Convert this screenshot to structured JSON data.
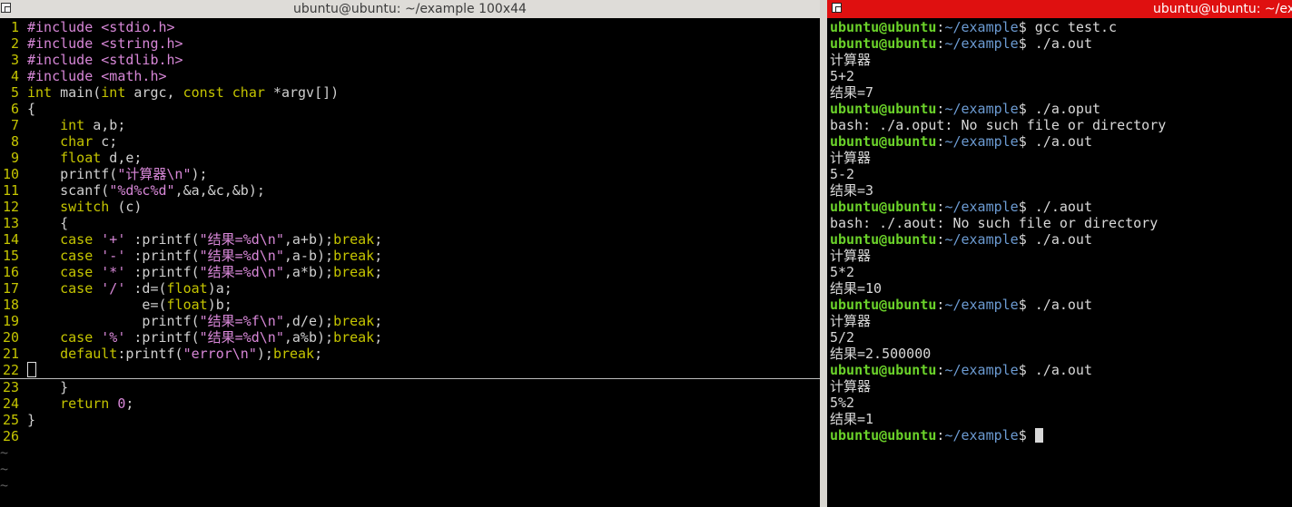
{
  "left_window": {
    "title": "ubuntu@ubuntu: ~/example 100x44",
    "icon": "terminal-window-icon"
  },
  "right_window": {
    "title": "ubuntu@ubuntu: ~/exa",
    "icon": "terminal-window-icon"
  },
  "vim": {
    "lines": [
      {
        "n": "1",
        "t": [
          [
            "pp",
            "#include "
          ],
          [
            "inc",
            "<stdio.h>"
          ]
        ]
      },
      {
        "n": "2",
        "t": [
          [
            "pp",
            "#include "
          ],
          [
            "inc",
            "<string.h>"
          ]
        ]
      },
      {
        "n": "3",
        "t": [
          [
            "pp",
            "#include "
          ],
          [
            "inc",
            "<stdlib.h>"
          ]
        ]
      },
      {
        "n": "4",
        "t": [
          [
            "pp",
            "#include "
          ],
          [
            "inc",
            "<math.h>"
          ]
        ]
      },
      {
        "n": "5",
        "t": [
          [
            "ty",
            "int"
          ],
          [
            "pl",
            " main("
          ],
          [
            "ty",
            "int"
          ],
          [
            "pl",
            " argc, "
          ],
          [
            "ty",
            "const"
          ],
          [
            "pl",
            " "
          ],
          [
            "ty",
            "char"
          ],
          [
            "pl",
            " *argv[])"
          ]
        ]
      },
      {
        "n": "6",
        "t": [
          [
            "pl",
            "{"
          ]
        ]
      },
      {
        "n": "7",
        "t": [
          [
            "pl",
            "    "
          ],
          [
            "ty",
            "int"
          ],
          [
            "pl",
            " a,b;"
          ]
        ]
      },
      {
        "n": "8",
        "t": [
          [
            "pl",
            "    "
          ],
          [
            "ty",
            "char"
          ],
          [
            "pl",
            " c;"
          ]
        ]
      },
      {
        "n": "9",
        "t": [
          [
            "pl",
            "    "
          ],
          [
            "ty",
            "float"
          ],
          [
            "pl",
            " d,e;"
          ]
        ]
      },
      {
        "n": "10",
        "t": [
          [
            "pl",
            "    printf("
          ],
          [
            "st",
            "\"计算器"
          ],
          [
            "nm",
            "\\n"
          ],
          [
            "st",
            "\""
          ],
          [
            "pl",
            ");"
          ]
        ]
      },
      {
        "n": "11",
        "t": [
          [
            "pl",
            "    scanf("
          ],
          [
            "st",
            "\""
          ],
          [
            "nm",
            "%d%c%d"
          ],
          [
            "st",
            "\""
          ],
          [
            "pl",
            ",&a,&c,&b);"
          ]
        ]
      },
      {
        "n": "12",
        "t": [
          [
            "pl",
            "    "
          ],
          [
            "kw",
            "switch"
          ],
          [
            "pl",
            " (c)"
          ]
        ]
      },
      {
        "n": "13",
        "t": [
          [
            "pl",
            "    {"
          ]
        ]
      },
      {
        "n": "14",
        "t": [
          [
            "pl",
            "    "
          ],
          [
            "kw",
            "case"
          ],
          [
            "pl",
            " "
          ],
          [
            "st",
            "'+'"
          ],
          [
            "pl",
            " :printf("
          ],
          [
            "st",
            "\"结果="
          ],
          [
            "nm",
            "%d\\n"
          ],
          [
            "st",
            "\""
          ],
          [
            "pl",
            ",a+b);"
          ],
          [
            "kw",
            "break"
          ],
          [
            "pl",
            ";"
          ]
        ]
      },
      {
        "n": "15",
        "t": [
          [
            "pl",
            "    "
          ],
          [
            "kw",
            "case"
          ],
          [
            "pl",
            " "
          ],
          [
            "st",
            "'-'"
          ],
          [
            "pl",
            " :printf("
          ],
          [
            "st",
            "\"结果="
          ],
          [
            "nm",
            "%d\\n"
          ],
          [
            "st",
            "\""
          ],
          [
            "pl",
            ",a-b);"
          ],
          [
            "kw",
            "break"
          ],
          [
            "pl",
            ";"
          ]
        ]
      },
      {
        "n": "16",
        "t": [
          [
            "pl",
            "    "
          ],
          [
            "kw",
            "case"
          ],
          [
            "pl",
            " "
          ],
          [
            "st",
            "'*'"
          ],
          [
            "pl",
            " :printf("
          ],
          [
            "st",
            "\"结果="
          ],
          [
            "nm",
            "%d\\n"
          ],
          [
            "st",
            "\""
          ],
          [
            "pl",
            ",a*b);"
          ],
          [
            "kw",
            "break"
          ],
          [
            "pl",
            ";"
          ]
        ]
      },
      {
        "n": "17",
        "t": [
          [
            "pl",
            "    "
          ],
          [
            "kw",
            "case"
          ],
          [
            "pl",
            " "
          ],
          [
            "st",
            "'/'"
          ],
          [
            "pl",
            " :d=("
          ],
          [
            "ty",
            "float"
          ],
          [
            "pl",
            ")a;"
          ]
        ]
      },
      {
        "n": "18",
        "t": [
          [
            "pl",
            "              e=("
          ],
          [
            "ty",
            "float"
          ],
          [
            "pl",
            ")b;"
          ]
        ]
      },
      {
        "n": "19",
        "t": [
          [
            "pl",
            "              printf("
          ],
          [
            "st",
            "\"结果="
          ],
          [
            "nm",
            "%f\\n"
          ],
          [
            "st",
            "\""
          ],
          [
            "pl",
            ",d/e);"
          ],
          [
            "kw",
            "break"
          ],
          [
            "pl",
            ";"
          ]
        ]
      },
      {
        "n": "20",
        "t": [
          [
            "pl",
            "    "
          ],
          [
            "kw",
            "case"
          ],
          [
            "pl",
            " "
          ],
          [
            "st",
            "'%'"
          ],
          [
            "pl",
            " :printf("
          ],
          [
            "st",
            "\"结果="
          ],
          [
            "nm",
            "%d\\n"
          ],
          [
            "st",
            "\""
          ],
          [
            "pl",
            ",a%b);"
          ],
          [
            "kw",
            "break"
          ],
          [
            "pl",
            ";"
          ]
        ]
      },
      {
        "n": "21",
        "t": [
          [
            "pl",
            "    "
          ],
          [
            "kw",
            "default"
          ],
          [
            "pl",
            ":printf("
          ],
          [
            "st",
            "\"error"
          ],
          [
            "nm",
            "\\n"
          ],
          [
            "st",
            "\""
          ],
          [
            "pl",
            ");"
          ],
          [
            "kw",
            "break"
          ],
          [
            "pl",
            ";"
          ]
        ]
      },
      {
        "n": "22",
        "t": [],
        "cursor": true
      },
      {
        "n": "23",
        "t": [
          [
            "pl",
            "    }"
          ]
        ]
      },
      {
        "n": "24",
        "t": [
          [
            "pl",
            "    "
          ],
          [
            "kw",
            "return"
          ],
          [
            "pl",
            " "
          ],
          [
            "nm",
            "0"
          ],
          [
            "pl",
            ";"
          ]
        ]
      },
      {
        "n": "25",
        "t": [
          [
            "pl",
            "}"
          ]
        ]
      },
      {
        "n": "26",
        "t": []
      }
    ],
    "tilde": "~",
    "tilde_count": 3
  },
  "shell": {
    "user": "ubuntu@ubuntu",
    "colon": ":",
    "path": "~/example",
    "prompt_suffix": "$ ",
    "lines": [
      {
        "cmd": "gcc test.c"
      },
      {
        "cmd": "./a.out"
      },
      {
        "out": "计算器"
      },
      {
        "out": "5+2"
      },
      {
        "out": "结果=7"
      },
      {
        "cmd": "./a.oput"
      },
      {
        "out": "bash: ./a.oput: No such file or directory"
      },
      {
        "cmd": "./a.out"
      },
      {
        "out": "计算器"
      },
      {
        "out": "5-2"
      },
      {
        "out": "结果=3"
      },
      {
        "cmd": "./.aout"
      },
      {
        "out": "bash: ./.aout: No such file or directory"
      },
      {
        "cmd": "./a.out"
      },
      {
        "out": "计算器"
      },
      {
        "out": "5*2"
      },
      {
        "out": "结果=10"
      },
      {
        "cmd": "./a.out"
      },
      {
        "out": "计算器"
      },
      {
        "out": "5/2"
      },
      {
        "out": "结果=2.500000"
      },
      {
        "cmd": "./a.out"
      },
      {
        "out": "计算器"
      },
      {
        "out": "5%2"
      },
      {
        "out": "结果=1"
      },
      {
        "cmd": "",
        "cursor": true
      }
    ]
  }
}
